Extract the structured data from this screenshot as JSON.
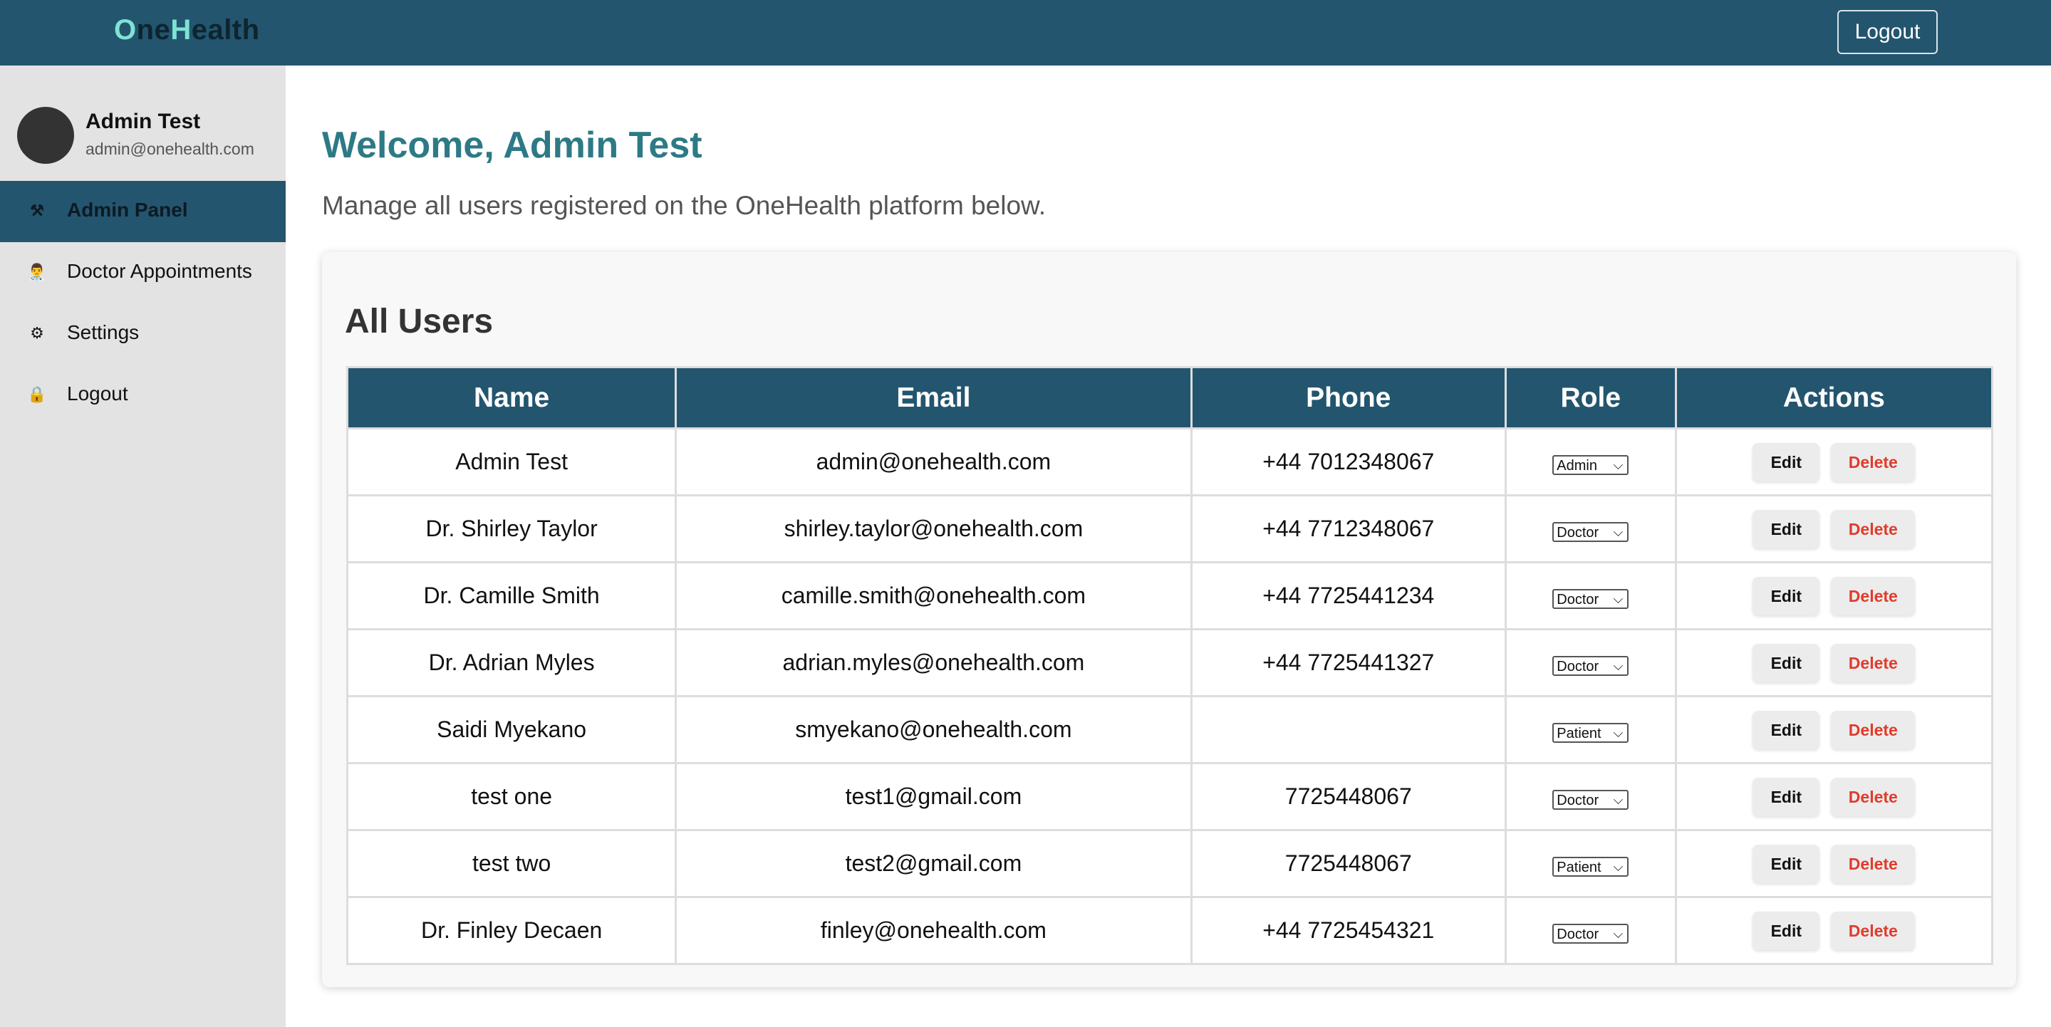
{
  "header": {
    "logo_o": "O",
    "logo_ne": "ne",
    "logo_h": "H",
    "logo_ealth": "ealth",
    "logout_label": "Logout"
  },
  "sidebar": {
    "user_name": "Admin Test",
    "user_email": "admin@onehealth.com",
    "items": [
      {
        "label": "Admin Panel",
        "icon": "hammer-wrench-icon",
        "glyph": "⚒"
      },
      {
        "label": "Doctor Appointments",
        "icon": "doctor-icon",
        "glyph": "👨‍⚕️"
      },
      {
        "label": "Settings",
        "icon": "gear-icon",
        "glyph": "⚙"
      },
      {
        "label": "Logout",
        "icon": "lock-icon",
        "glyph": "🔒"
      }
    ]
  },
  "main": {
    "welcome": "Welcome, Admin Test",
    "subtitle": "Manage all users registered on the OneHealth platform below.",
    "card_title": "All Users",
    "columns": [
      "Name",
      "Email",
      "Phone",
      "Role",
      "Actions"
    ],
    "edit_label": "Edit",
    "delete_label": "Delete",
    "rows": [
      {
        "name": "Admin Test",
        "email": "admin@onehealth.com",
        "phone": "+44 7012348067",
        "role": "Admin"
      },
      {
        "name": "Dr. Shirley Taylor",
        "email": "shirley.taylor@onehealth.com",
        "phone": "+44 7712348067",
        "role": "Doctor"
      },
      {
        "name": "Dr. Camille Smith",
        "email": "camille.smith@onehealth.com",
        "phone": "+44 7725441234",
        "role": "Doctor"
      },
      {
        "name": "Dr. Adrian Myles",
        "email": "adrian.myles@onehealth.com",
        "phone": "+44 7725441327",
        "role": "Doctor"
      },
      {
        "name": "Saidi Myekano",
        "email": "smyekano@onehealth.com",
        "phone": "",
        "role": "Patient"
      },
      {
        "name": "test one",
        "email": "test1@gmail.com",
        "phone": "7725448067",
        "role": "Doctor"
      },
      {
        "name": "test two",
        "email": "test2@gmail.com",
        "phone": "7725448067",
        "role": "Patient"
      },
      {
        "name": "Dr. Finley Decaen",
        "email": "finley@onehealth.com",
        "phone": "+44 7725454321",
        "role": "Doctor"
      }
    ]
  },
  "colors": {
    "header_bg": "#23556f",
    "accent_teal": "#2d7a86",
    "logo_accent": "#7fe3d4",
    "delete_red": "#e03b2c",
    "sidebar_bg": "#e3e3e3"
  }
}
